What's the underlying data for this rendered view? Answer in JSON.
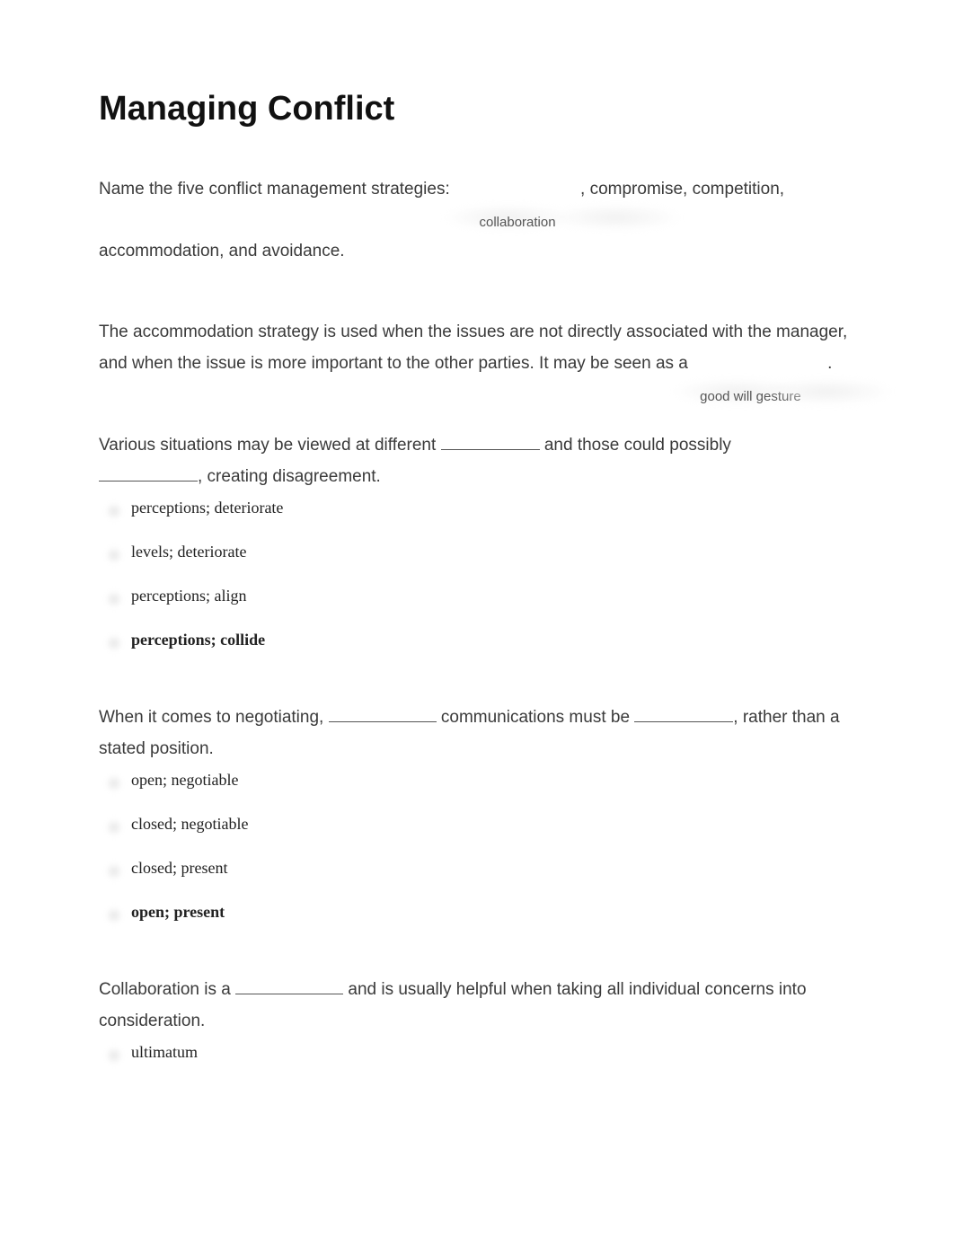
{
  "title": "Managing Conflict",
  "q1": {
    "part1": "Name the five conflict management strategies: ",
    "answer1": "collaboration",
    "part2": ", compromise, competition,",
    "part3": "accommodation, and avoidance."
  },
  "q2": {
    "part1": "The accommodation strategy is used when the issues are not directly associated with the manager, and when the issue is more important to the other parties. It may be seen as a ",
    "answer": "good will gesture",
    "part2": "."
  },
  "q3": {
    "prompt_a": "Various situations may be viewed at different ",
    "prompt_b": " and those could possibly ",
    "prompt_c": ", creating disagreement.",
    "options": [
      {
        "text": "perceptions; deteriorate",
        "correct": false
      },
      {
        "text": "levels; deteriorate",
        "correct": false
      },
      {
        "text": "perceptions; align",
        "correct": false
      },
      {
        "text": "perceptions; collide",
        "correct": true
      }
    ]
  },
  "q4": {
    "prompt_a": "When it comes to negotiating, ",
    "prompt_b": " communications must be ",
    "prompt_c": ", rather than a stated position.",
    "options": [
      {
        "text": "open; negotiable",
        "correct": false
      },
      {
        "text": "closed; negotiable",
        "correct": false
      },
      {
        "text": "closed; present",
        "correct": false
      },
      {
        "text": "open; present",
        "correct": true
      }
    ]
  },
  "q5": {
    "prompt_a": "Collaboration is a ",
    "prompt_b": " and is usually helpful when taking all individual concerns into consideration.",
    "options": [
      {
        "text": "ultimatum",
        "correct": false
      }
    ]
  }
}
